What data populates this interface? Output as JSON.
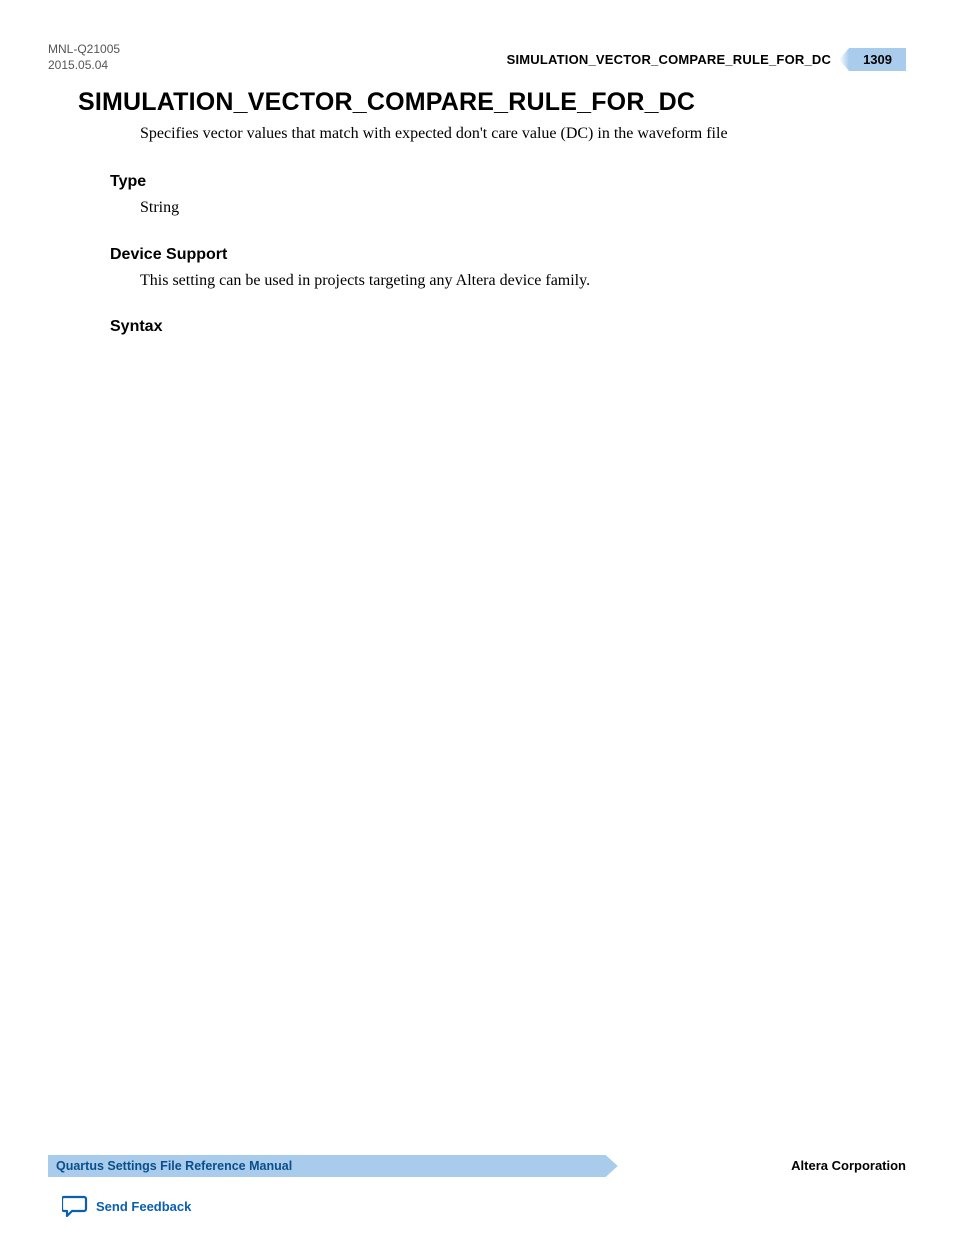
{
  "header": {
    "doc_id": "MNL-Q21005",
    "date": "2015.05.04",
    "running_title": "SIMULATION_VECTOR_COMPARE_RULE_FOR_DC",
    "page_number": "1309"
  },
  "main": {
    "heading": "SIMULATION_VECTOR_COMPARE_RULE_FOR_DC",
    "description": "Specifies vector values that match with expected don't care value (DC) in the waveform file",
    "sections": {
      "type": {
        "label": "Type",
        "body": "String"
      },
      "device_support": {
        "label": "Device Support",
        "body": "This setting can be used in projects targeting any Altera device family."
      },
      "syntax": {
        "label": "Syntax"
      }
    }
  },
  "footer": {
    "manual_title": "Quartus Settings File Reference Manual",
    "company": "Altera Corporation",
    "feedback_label": "Send Feedback"
  }
}
